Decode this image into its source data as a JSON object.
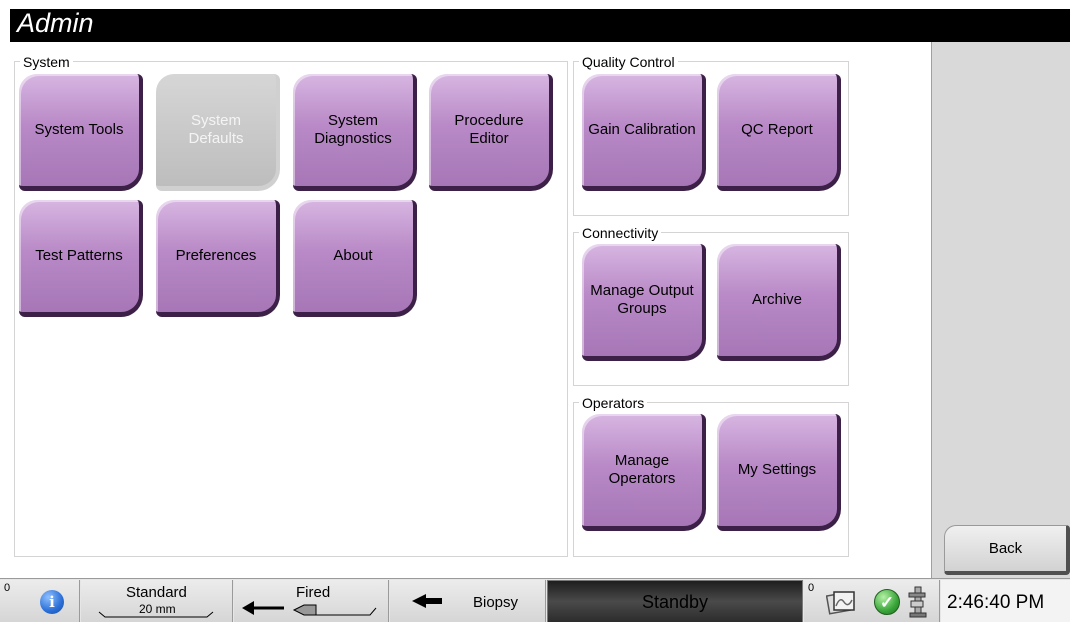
{
  "window": {
    "title": "Admin"
  },
  "groups": {
    "system": {
      "label": "System",
      "buttons": [
        {
          "label": "System Tools",
          "enabled": true
        },
        {
          "label": "System\nDefaults",
          "enabled": false
        },
        {
          "label": "System\nDiagnostics",
          "enabled": true
        },
        {
          "label": "Procedure\nEditor",
          "enabled": true
        },
        {
          "label": "Test Patterns",
          "enabled": true
        },
        {
          "label": "Preferences",
          "enabled": true
        },
        {
          "label": "About",
          "enabled": true
        }
      ]
    },
    "quality_control": {
      "label": "Quality Control",
      "buttons": [
        {
          "label": "Gain Calibration"
        },
        {
          "label": "QC Report"
        }
      ]
    },
    "connectivity": {
      "label": "Connectivity",
      "buttons": [
        {
          "label": "Manage Output\nGroups"
        },
        {
          "label": "Archive"
        }
      ]
    },
    "operators": {
      "label": "Operators",
      "buttons": [
        {
          "label": "Manage\nOperators"
        },
        {
          "label": "My Settings"
        }
      ]
    }
  },
  "right_panel": {
    "back_label": "Back"
  },
  "status_bar": {
    "alarm_count": "0",
    "info_icon": "info-icon",
    "paddle_name": "Standard",
    "paddle_size": "20 mm",
    "exposure_state": "Fired",
    "biopsy_label": "Biopsy",
    "system_state": "Standby",
    "output_count": "0",
    "clock": "2:46:40 PM",
    "colors": {
      "standby_bg": "#3a3a3a",
      "ok_green": "#3aa63a",
      "info_blue": "#2a6fd6"
    }
  }
}
